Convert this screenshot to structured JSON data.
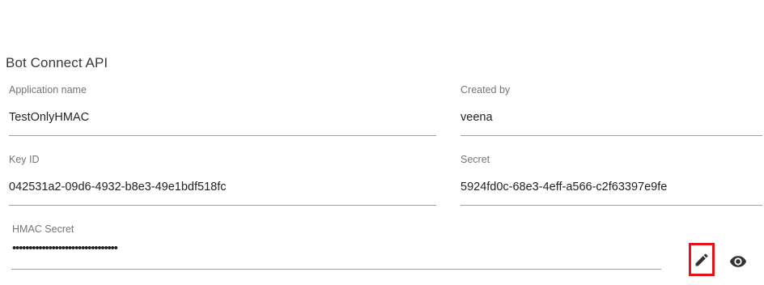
{
  "section": {
    "title": "Bot Connect API"
  },
  "fields": {
    "application_name": {
      "label": "Application name",
      "value": "TestOnlyHMAC"
    },
    "created_by": {
      "label": "Created by",
      "value": "veena"
    },
    "key_id": {
      "label": "Key ID",
      "value": "042531a2-09d6-4932-b8e3-49e1bdf518fc"
    },
    "secret": {
      "label": "Secret",
      "value": "5924fd0c-68e3-4eff-a566-c2f63397e9fe"
    },
    "hmac_secret": {
      "label": "HMAC Secret",
      "masked_value": "••••••••••••••••••••••••••••••••"
    }
  },
  "actions": {
    "edit_icon": "pencil-icon",
    "view_icon": "eye-icon",
    "edit_highlight_color": "#e5141b",
    "icon_color": "#333333"
  }
}
